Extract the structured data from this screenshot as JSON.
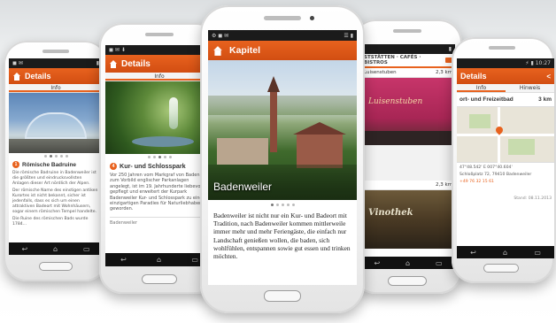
{
  "phone1": {
    "title": "Details",
    "tab": "Info",
    "section_title": "Römische Badruine",
    "p1": "Die römische Badruine in Badenweiler ist die größten und eindrucksvollsten Anlagen dieser Art nördlich der Alpen.",
    "p2": "Der römische Name des einstigen antiken Kurortes ist nicht bekannt, sicher ist jedenfalls, dass es sich um einen attraktiven Badeort mit Wohnhäusern, sogar einem römischen Tempel handelte.",
    "p3": "Die Ruine des römischen Bads wurde 1784..."
  },
  "phone2": {
    "title": "Details",
    "tab": "Info",
    "section_title": "Kur- und Schlosspark",
    "p1": "Vor 250 Jahren vom Markgraf von Baden zum Vorbild englischer Parkanlagen angelegt, ist im 19. Jahrhunderte liebevoll gepflegt und erweitert der Kurpark Badenweiler Kur- und Schlosspark zu einem einzigartigen Paradies für Naturliebhaber geworden.",
    "footer": "Badenweiler"
  },
  "phone3": {
    "title": "Kapitel",
    "caption": "Badenweiler",
    "body": "Badenweiler ist nicht nur ein Kur- und Badeort mit Tradition, nach Badenweiler kommen mittlerweile immer mehr und mehr Feriengäste, die einfach nur Landschaft genießen wollen, die baden, sich wohlfühlen, entspannen sowie gut essen und trinken möchten."
  },
  "phone4": {
    "header": "STSTÄTTEN · CAFÉS · BISTROS",
    "row1_name": "Luisenstuben",
    "row1_dist": "2,3 km",
    "row2_dist": "2,3 km",
    "sign1": "Luisenstuben",
    "sign2": "Vinothek"
  },
  "phone5": {
    "title": "Details",
    "tab1": "Info",
    "tab2": "Hinweis",
    "place": "ort- und Freizeitbad",
    "dist": "3 km",
    "coords": "47°48.542' E 007°40.604'",
    "address": "Schloßplatz 72, 79410 Badenweiler",
    "phone": "+49 76 32 15 61",
    "stand": "Stand: 08.11.2013"
  }
}
